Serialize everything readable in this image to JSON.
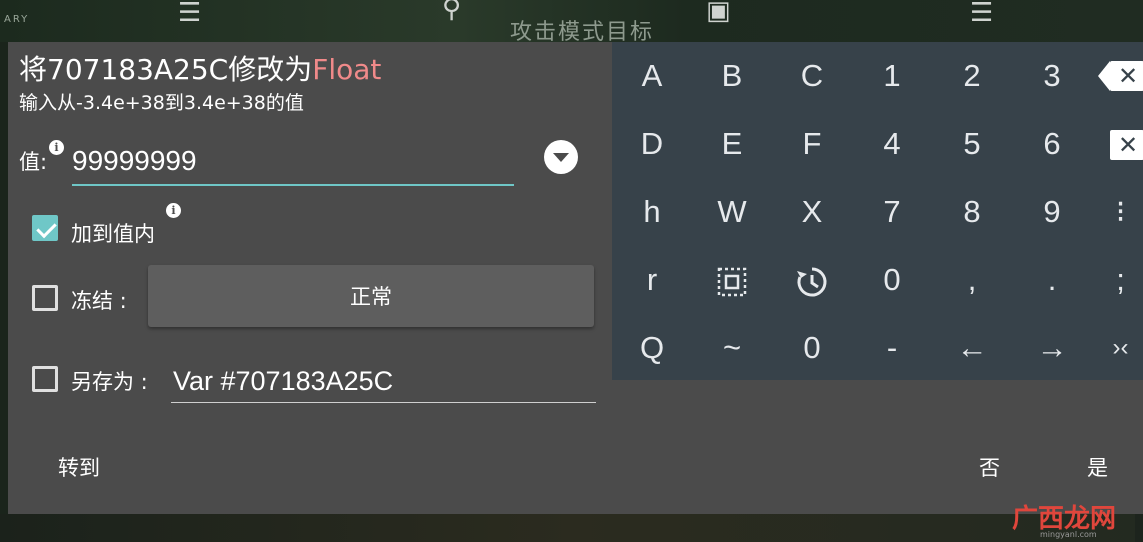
{
  "dialog": {
    "title_prefix": "将707183A25C修改为",
    "title_type": "Float",
    "subtitle": "输入从-3.4e+38到3.4e+38的值",
    "value_label": "值:",
    "value": "99999999",
    "add_to_value_label": "加到值内",
    "add_to_value_checked": true,
    "freeze_label": "冻结 :",
    "freeze_checked": false,
    "freeze_mode": "正常",
    "save_as_label": "另存为 :",
    "save_as_checked": false,
    "save_as_value": "Var #707183A25C",
    "goto_label": "转到",
    "no_label": "否",
    "yes_label": "是"
  },
  "keypad": {
    "rows": [
      [
        "A",
        "B",
        "C",
        "1",
        "2",
        "3"
      ],
      [
        "D",
        "E",
        "F",
        "4",
        "5",
        "6"
      ],
      [
        "h",
        "W",
        "X",
        "7",
        "8",
        "9"
      ],
      [
        "r",
        "",
        "",
        "0",
        ",",
        "."
      ],
      [
        "Q",
        "~",
        "0",
        "-",
        "←",
        "→"
      ]
    ],
    "special_icons": [
      "select-all-icon",
      "history-icon",
      "backspace-icon"
    ],
    "edge_glyphs": [
      "⁝",
      ";",
      "›‹"
    ]
  },
  "watermark": {
    "text": "广西龙网",
    "sub": "mingyanl.com"
  },
  "colors": {
    "dialog_bg": "#4b4b4b",
    "keypad_bg": "#37424a",
    "accent": "#6fc7c7",
    "type_highlight": "#f08a8a"
  }
}
